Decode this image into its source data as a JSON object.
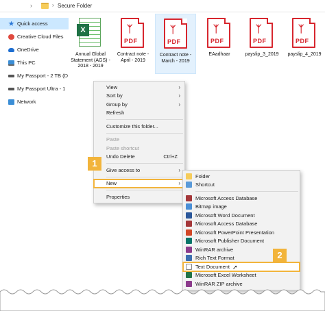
{
  "address": {
    "path": "Secure Folder"
  },
  "sidebar": {
    "items": [
      {
        "label": "Quick access",
        "icon": "star-icon",
        "color": "#2b79d8",
        "active": true
      },
      {
        "label": "Creative Cloud Files",
        "icon": "creative-cloud-icon",
        "color": "#e04a3f"
      },
      {
        "label": "OneDrive",
        "icon": "cloud-icon",
        "color": "#1f6fd1"
      },
      {
        "label": "This PC",
        "icon": "pc-icon",
        "color": "#3b8ed6"
      },
      {
        "label": "My Passport - 2 TB (D",
        "icon": "drive-icon",
        "color": "#555555"
      },
      {
        "label": "My Passport Ultra - 1",
        "icon": "drive-icon",
        "color": "#555555"
      },
      {
        "label": "Network",
        "icon": "network-icon",
        "color": "#3b8ed6"
      }
    ]
  },
  "files": [
    {
      "name": "Annual Global Statement (AGS) - 2018 - 2019",
      "type": "excel"
    },
    {
      "name": "Contract note - April - 2019",
      "type": "pdf"
    },
    {
      "name": "Contract note - March - 2019",
      "type": "pdf"
    },
    {
      "name": "EAadhaar",
      "type": "pdf"
    },
    {
      "name": "payslip_3_2019",
      "type": "pdf"
    },
    {
      "name": "payslip_4_2019",
      "type": "pdf"
    }
  ],
  "context_menu": {
    "view": "View",
    "sort_by": "Sort by",
    "group_by": "Group by",
    "refresh": "Refresh",
    "customize": "Customize this folder...",
    "paste": "Paste",
    "paste_shortcut": "Paste shortcut",
    "undo_delete": "Undo Delete",
    "undo_shortcut": "Ctrl+Z",
    "give_access": "Give access to",
    "new": "New",
    "properties": "Properties"
  },
  "new_submenu": {
    "folder": "Folder",
    "shortcut": "Shortcut",
    "items": [
      {
        "label": "Microsoft Access Database",
        "color": "#a4373a"
      },
      {
        "label": "Bitmap image",
        "color": "#4a8fd6"
      },
      {
        "label": "Microsoft Word Document",
        "color": "#2b579a"
      },
      {
        "label": "Microsoft Access Database",
        "color": "#a4373a"
      },
      {
        "label": "Microsoft PowerPoint Presentation",
        "color": "#d24726"
      },
      {
        "label": "Microsoft Publisher Document",
        "color": "#077568"
      },
      {
        "label": "WinRAR archive",
        "color": "#8b3a8b"
      },
      {
        "label": "Rich Text Format",
        "color": "#3c6fb0"
      }
    ],
    "text_document": "Text Document",
    "items_after": [
      {
        "label": "Microsoft Excel Worksheet",
        "color": "#217346"
      },
      {
        "label": "WinRAR ZIP archive",
        "color": "#8b3a8b"
      }
    ]
  },
  "callouts": {
    "one": "1",
    "two": "2"
  },
  "colors": {
    "accent": "#f2b43b",
    "selection": "#cce8ff",
    "pdf_red": "#d7262e"
  }
}
